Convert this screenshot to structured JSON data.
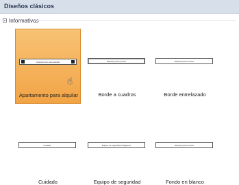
{
  "header": {
    "title": "Diseños clásicos"
  },
  "section": {
    "label": "Informativas"
  },
  "tiles": [
    {
      "caption": "Apartamento para alquilar",
      "preview_text": "Apartamento para alquilar"
    },
    {
      "caption": "Borde a cuadros",
      "preview_text": "Espacio para el texto"
    },
    {
      "caption": "Borde entrelazado",
      "preview_text": "Espacio para el texto"
    },
    {
      "caption": "Cuidado",
      "preview_text": "Cuidado"
    },
    {
      "caption": "Equipo de seguridad",
      "preview_text": "Equipo de seguridad obligatorio"
    },
    {
      "caption": "Fondo en blanco",
      "preview_text": "Espacio para el texto"
    }
  ],
  "colors": {
    "selected_tile": "#f2a445",
    "header_bg": "#d7dfea"
  },
  "icons": {
    "cursor": "hand-pointer-icon",
    "section_toggle": "collapse-minus-icon"
  }
}
